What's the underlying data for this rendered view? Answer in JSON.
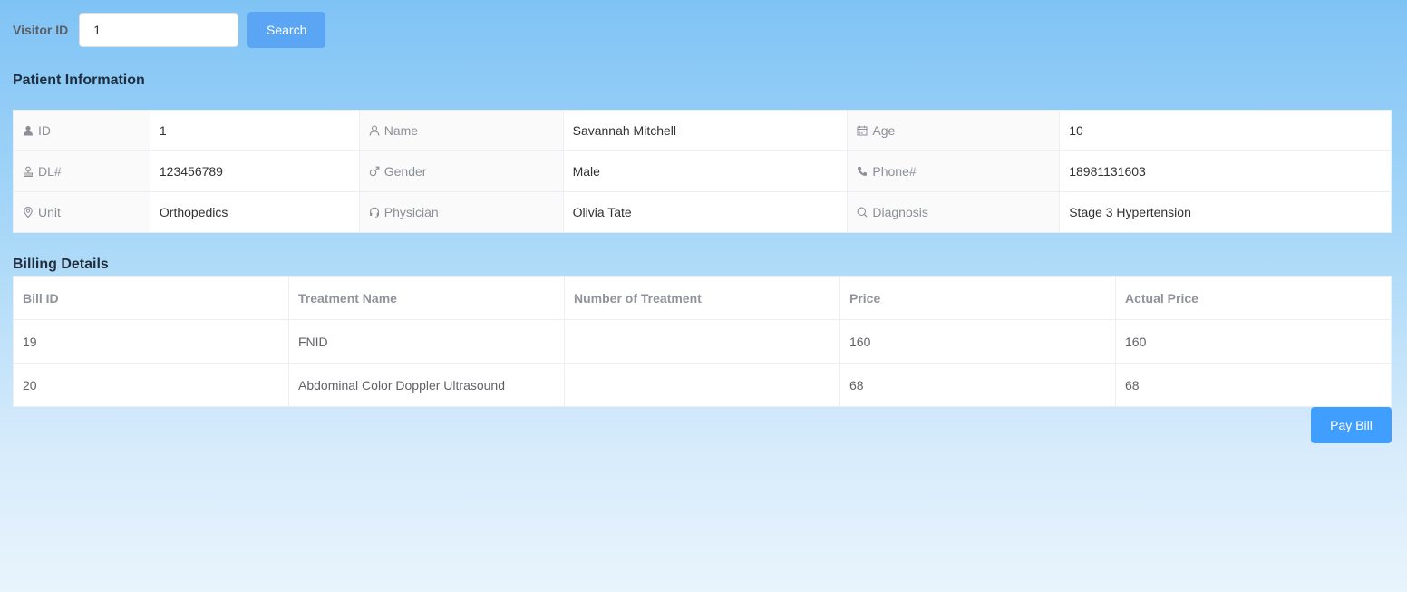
{
  "search": {
    "label": "Visitor ID",
    "value": "1",
    "button_label": "Search"
  },
  "patient": {
    "title": "Patient Information",
    "fields": {
      "id": {
        "label": "ID",
        "value": "1",
        "icon": "user-filled-icon"
      },
      "name": {
        "label": "Name",
        "value": "Savannah Mitchell",
        "icon": "user-icon"
      },
      "age": {
        "label": "Age",
        "value": "10",
        "icon": "calendar-icon"
      },
      "dl": {
        "label": "DL#",
        "value": "123456789",
        "icon": "stamp-icon"
      },
      "gender": {
        "label": "Gender",
        "value": "Male",
        "icon": "male-icon"
      },
      "phone": {
        "label": "Phone#",
        "value": "18981131603",
        "icon": "phone-icon"
      },
      "unit": {
        "label": "Unit",
        "value": "Orthopedics",
        "icon": "location-icon"
      },
      "physician": {
        "label": "Physician",
        "value": "Olivia Tate",
        "icon": "headset-icon"
      },
      "diagnosis": {
        "label": "Diagnosis",
        "value": "Stage 3 Hypertension",
        "icon": "search-icon"
      }
    }
  },
  "billing": {
    "title": "Billing Details",
    "columns": [
      "Bill ID",
      "Treatment Name",
      "Number of Treatment",
      "Price",
      "Actual Price"
    ],
    "rows": [
      [
        "19",
        "FNID",
        "",
        "160",
        "160"
      ],
      [
        "20",
        "Abdominal Color Doppler Ultrasound",
        "",
        "68",
        "68"
      ]
    ],
    "pay_button_label": "Pay Bill"
  },
  "colors": {
    "primary": "#409eff",
    "search_button": "#5aa6f5",
    "background_top": "#7fc3f5",
    "background_bottom": "#e9f4fc"
  }
}
